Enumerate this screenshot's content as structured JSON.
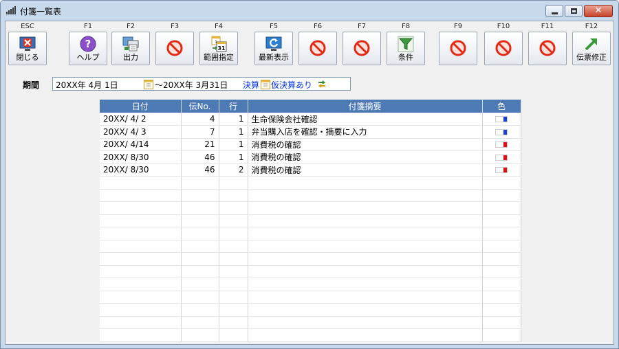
{
  "window": {
    "title": "付箋一覧表",
    "close_glyph": "✕"
  },
  "toolbar": {
    "buttons": [
      {
        "key": "ESC",
        "label": "閉じる",
        "icon": "close-screen-icon"
      },
      {
        "key": "F1",
        "label": "ヘルプ",
        "icon": "help-icon"
      },
      {
        "key": "F2",
        "label": "出力",
        "icon": "print-output-icon"
      },
      {
        "key": "F3",
        "label": "",
        "icon": "disabled-icon"
      },
      {
        "key": "F4",
        "label": "範囲指定",
        "icon": "calendar-range-icon"
      },
      {
        "key": "F5",
        "label": "最新表示",
        "icon": "refresh-icon"
      },
      {
        "key": "F6",
        "label": "",
        "icon": "disabled-icon"
      },
      {
        "key": "F7",
        "label": "",
        "icon": "disabled-icon"
      },
      {
        "key": "F8",
        "label": "条件",
        "icon": "filter-icon"
      },
      {
        "key": "F9",
        "label": "",
        "icon": "disabled-icon"
      },
      {
        "key": "F10",
        "label": "",
        "icon": "disabled-icon"
      },
      {
        "key": "F11",
        "label": "",
        "icon": "disabled-icon"
      },
      {
        "key": "F12",
        "label": "伝票修正",
        "icon": "edit-arrow-icon"
      }
    ]
  },
  "period": {
    "label": "期間",
    "from": "20XX年  4月 1日",
    "to": "～20XX年  3月31日",
    "settlement": "決算",
    "provisional": "仮決算あり"
  },
  "grid": {
    "headers": [
      "日付",
      "伝No.",
      "行",
      "付箋摘要",
      "色"
    ],
    "rows": [
      {
        "date": "20XX/ 4/ 2",
        "no": "4",
        "line": "1",
        "memo": "生命保険会社確認",
        "color": "#1a3fd6"
      },
      {
        "date": "20XX/ 4/ 3",
        "no": "7",
        "line": "1",
        "memo": "弁当購入店を確認・摘要に入力",
        "color": "#1a3fd6"
      },
      {
        "date": "20XX/ 4/14",
        "no": "21",
        "line": "1",
        "memo": "消費税の確認",
        "color": "#e01010"
      },
      {
        "date": "20XX/ 8/30",
        "no": "46",
        "line": "1",
        "memo": "消費税の確認",
        "color": "#e01010"
      },
      {
        "date": "20XX/ 8/30",
        "no": "46",
        "line": "2",
        "memo": "消費税の確認",
        "color": "#e01010"
      }
    ]
  }
}
